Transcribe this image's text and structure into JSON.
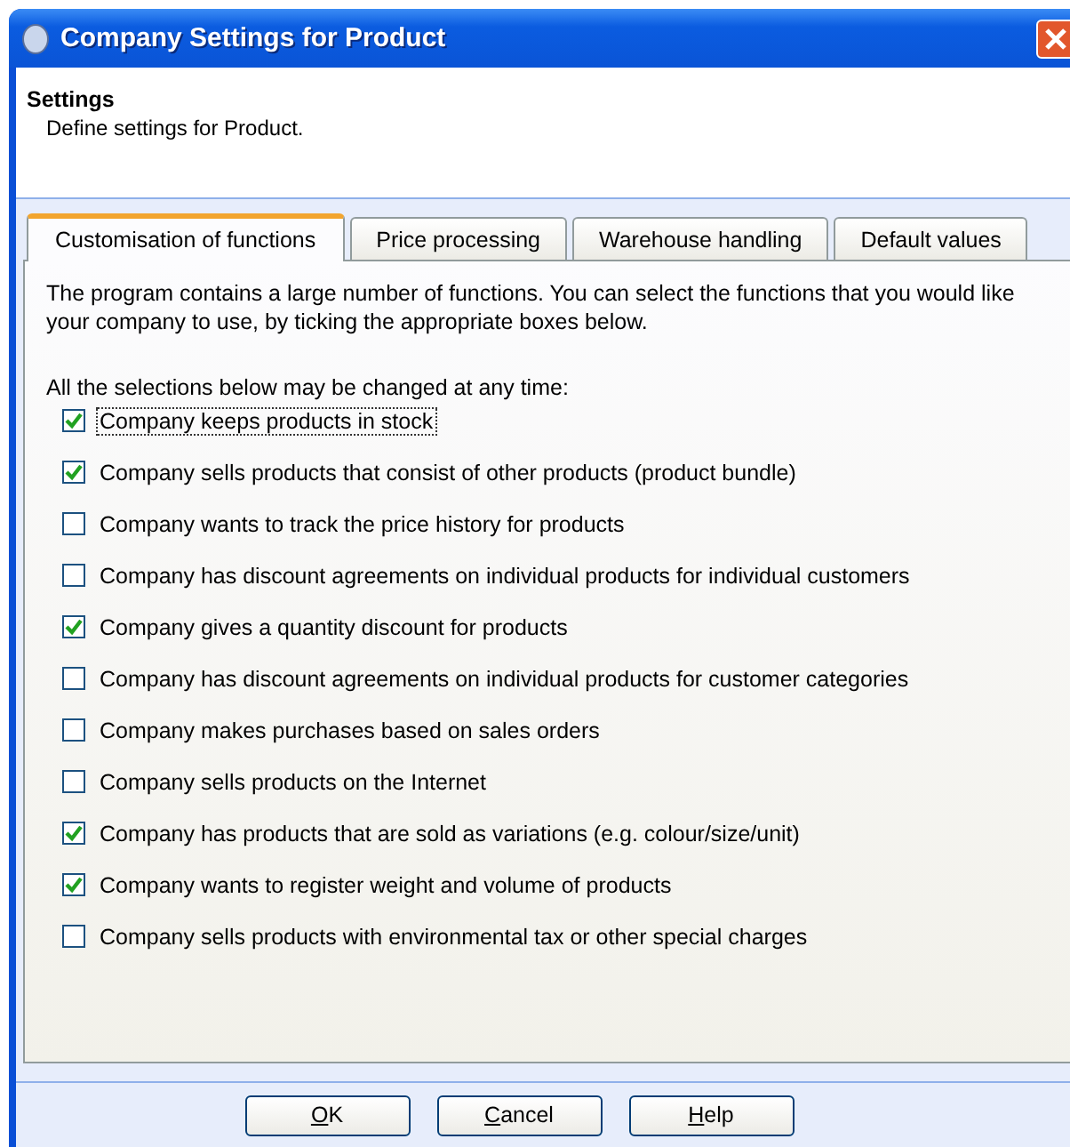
{
  "window": {
    "title": "Company Settings for Product"
  },
  "header": {
    "title": "Settings",
    "subtitle": "Define settings for Product."
  },
  "tabs": [
    {
      "label": "Customisation of functions",
      "selected": true
    },
    {
      "label": "Price processing",
      "selected": false
    },
    {
      "label": "Warehouse handling",
      "selected": false
    },
    {
      "label": "Default values",
      "selected": false
    }
  ],
  "intro": "The program contains a large number of functions. You can select the functions that you would like your company to use, by ticking the appropriate boxes below.",
  "note": "All the selections below may be changed at any time:",
  "options": [
    {
      "label": "Company keeps products in stock",
      "checked": true,
      "focused": true
    },
    {
      "label": "Company sells products that consist of other products (product bundle)",
      "checked": true,
      "focused": false
    },
    {
      "label": "Company wants to track the price history for products",
      "checked": false,
      "focused": false
    },
    {
      "label": "Company has discount agreements on individual products for individual customers",
      "checked": false,
      "focused": false
    },
    {
      "label": "Company gives a quantity discount for products",
      "checked": true,
      "focused": false
    },
    {
      "label": "Company has discount agreements on individual products for customer categories",
      "checked": false,
      "focused": false
    },
    {
      "label": "Company makes purchases based on sales orders",
      "checked": false,
      "focused": false
    },
    {
      "label": "Company sells products on the Internet",
      "checked": false,
      "focused": false
    },
    {
      "label": "Company has products that are sold as variations (e.g. colour/size/unit)",
      "checked": true,
      "focused": false
    },
    {
      "label": "Company wants to register weight and volume of products",
      "checked": true,
      "focused": false
    },
    {
      "label": "Company sells products with environmental tax or other special charges",
      "checked": false,
      "focused": false
    }
  ],
  "buttons": [
    "OK",
    "Cancel",
    "Help"
  ]
}
